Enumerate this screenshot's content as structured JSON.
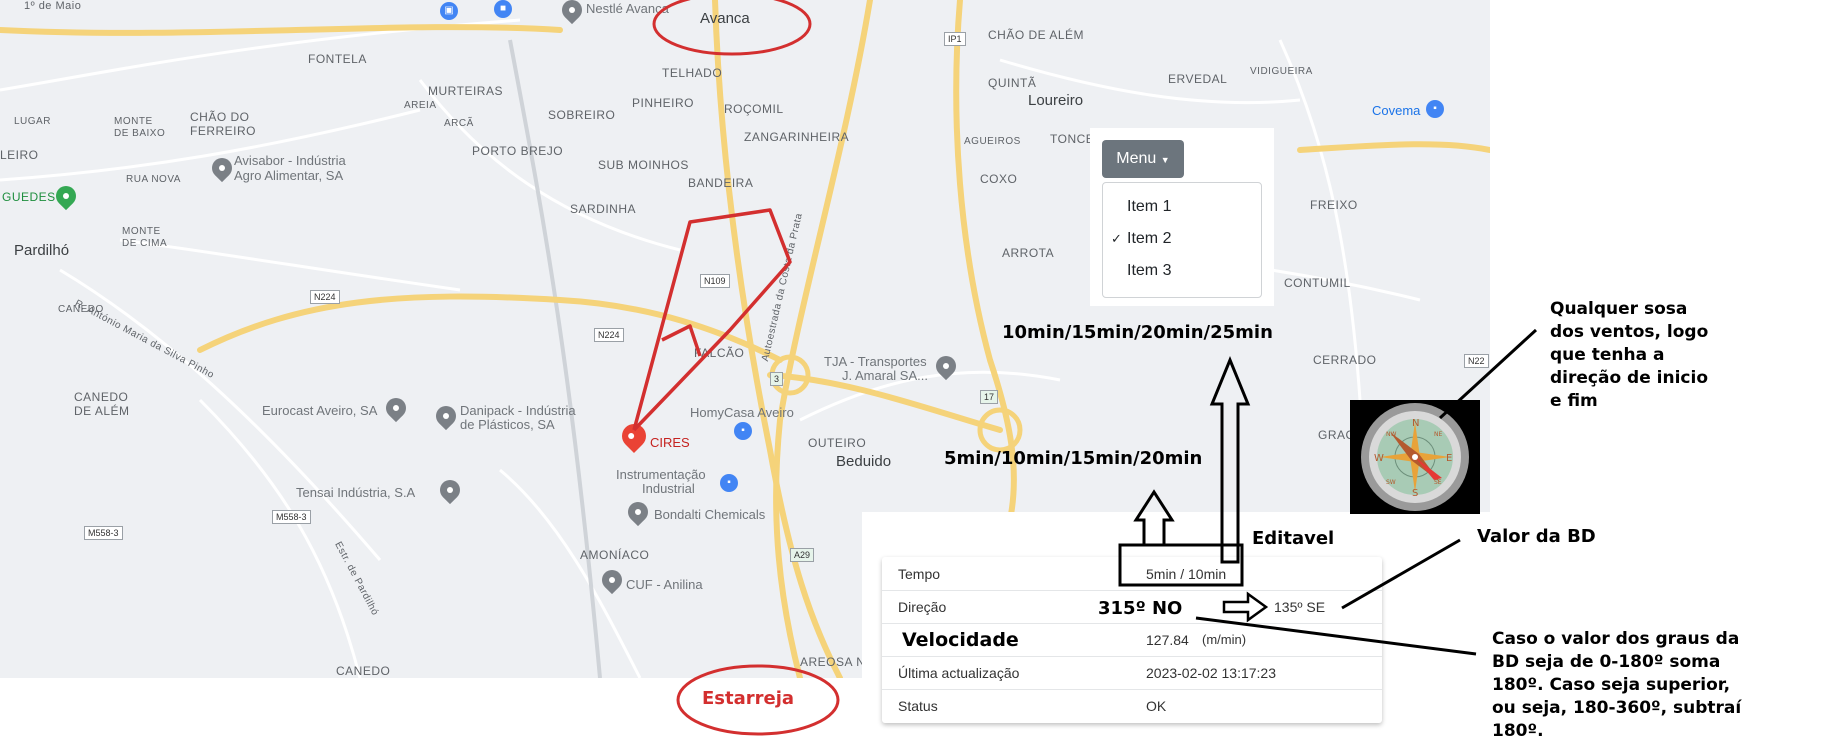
{
  "map": {
    "places": {
      "malo": "1º de Maio",
      "avanca": "Avanca",
      "fontela": "FONTELA",
      "murteiras": "MURTEIRAS",
      "telhado": "TELHADO",
      "chao_alem": "CHÃO DE ALÉM",
      "quinta": "QUINTÃ",
      "erveda": "ERVEDAL",
      "vidigueira": "VIDIGUEIRA",
      "lugar": "LUGAR",
      "chao_ferreiro_1": "CHÃO DO",
      "chao_ferreiro_2": "FERREIRO",
      "monte_baixo_1": "MONTE",
      "monte_baixo_2": "DE BAIXO",
      "areia": "AREIA",
      "arca": "ARCÃ",
      "sobreiro": "SOBREIRO",
      "pinheiro": "PINHEIRO",
      "rocomil": "ROÇOMIL",
      "loureiro": "Loureiro",
      "zangarinheira": "ZANGARINHEIRA",
      "porto_brejo": "PORTO BREJO",
      "agueiros": "AGUEIROS",
      "tonce": "TONCE",
      "leiro": "LEIRO",
      "rua_nova": "RUA NOVA",
      "sub_moinhos": "SUB MOINHOS",
      "bandeira": "BANDEIRA",
      "coxo": "COXO",
      "freixo": "FREIXO",
      "guedes": "GUEDES",
      "sardinha": "SARDINHA",
      "monte_cima_1": "MONTE",
      "monte_cima_2": "DE CIMA",
      "pardilho": "Pardilhó",
      "arrota": "ARROTA",
      "contumil": "CONTUMIL",
      "canedo": "CANEDO",
      "falcao": "FALCÃO",
      "cerrado": "CERRADO",
      "canedo_alem_1": "CANEDO",
      "canedo_alem_2": "DE ALÉM",
      "outeiro": "OUTEIRO",
      "beduido": "Beduido",
      "amoniaco": "AMONÍACO",
      "canedo_b": "CANEDO",
      "areosa": "AREOSA N",
      "grac": "GRAC",
      "road_antonio": "R. António Maria da Silva Pinho",
      "road_autoestrada": "Autoestrada da Costa da Prata",
      "road_estr_pardilho": "Estr. de Pardilhó"
    },
    "pois": {
      "nestle": "Nestlé Avanca",
      "covema": "Covema",
      "avisabor_1": "Avisabor - Indústria",
      "avisabor_2": "Agro Alimentar, SA",
      "tja_1": "TJA - Transportes",
      "tja_2": "J. Amaral SA...",
      "homycasa": "HomyCasa Aveiro",
      "eurocast": "Eurocast Aveiro, SA",
      "danipack_1": "Danipack - Indústria",
      "danipack_2": "de Plásticos, SA",
      "cires": "CIRES",
      "instrumentacao_1": "Instrumentação",
      "instrumentacao_2": "Industrial",
      "tensai": "Tensai Indústria, S.A",
      "bondalti": "Bondalti Chemicals",
      "cuf": "CUF - Anilina"
    },
    "shields": {
      "ip1": "IP1",
      "n109": "N109",
      "n224a": "N224",
      "n224b": "N224",
      "a17a": "17",
      "a17b": "17",
      "m558a": "M558-3",
      "m558b": "M558-3",
      "a29": "A29",
      "n22": "N22",
      "three": "3"
    }
  },
  "menu": {
    "button_label": "Menu",
    "items": [
      {
        "label": "Item 1",
        "checked": false
      },
      {
        "label": "Item 2",
        "checked": true
      },
      {
        "label": "Item 3",
        "checked": false
      }
    ],
    "check_glyph": "✓"
  },
  "info_table": {
    "rows": [
      {
        "key": "Tempo",
        "value": "5min / 10min"
      },
      {
        "key": "Direção",
        "value": "135º SE"
      },
      {
        "key": "Velocidade",
        "value": "127.84",
        "unit": "(m/min)"
      },
      {
        "key": "Última actualização",
        "value": "2023-02-02 13:17:23"
      },
      {
        "key": "Status",
        "value": "OK"
      }
    ]
  },
  "annotations": {
    "top_times": "10min/15min/20min/25min",
    "mid_times": "5min/10min/15min/20min",
    "editavel": "Editavel",
    "valor_bd": "Valor da BD",
    "direcao_calc": "315º NO",
    "compass_note": [
      "Qualquer sosa",
      "dos ventos, logo",
      "que tenha a",
      "direção de inicio",
      "e fim"
    ],
    "rule_note": [
      "Caso o valor dos graus da",
      "BD seja de 0-180º soma",
      "180º. Caso seja superior,",
      "ou seja, 180-360º, subtraí",
      "180º."
    ],
    "estarreja": "Estarreja"
  },
  "compass": {
    "letters": {
      "n": "N",
      "s": "S",
      "e": "E",
      "w": "W",
      "ne": "NE",
      "nw": "NW",
      "se": "SE",
      "sw": "SW"
    }
  },
  "colors": {
    "annotation_red": "#d32f2f",
    "map_bg": "#eef0f3",
    "menu_button": "#6c757d",
    "road_yellow": "#f5d37a"
  }
}
